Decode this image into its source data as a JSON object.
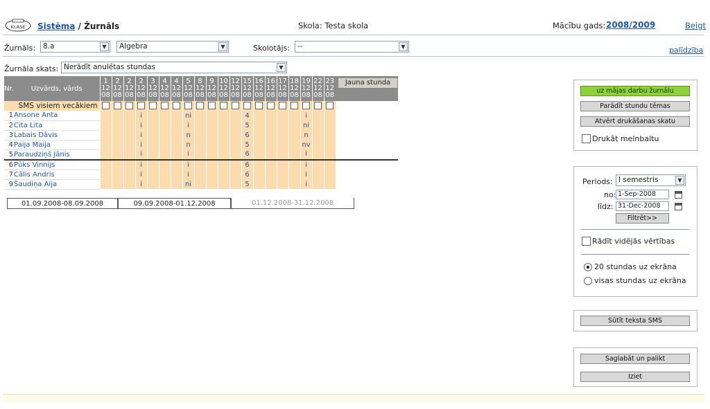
{
  "header": {
    "logo_text": "KLASE",
    "crumb_system": "Sistēma",
    "crumb_sep": " / ",
    "crumb_page": "Žurnāls",
    "school": "Skola: Testa skola",
    "year_label": "Mācību gads:",
    "year_value": "2008/2009",
    "logout": "Beigt"
  },
  "filters": {
    "journal_label": "Žurnāls:",
    "journal_value": "8.a",
    "subject_value": "Algebra",
    "teacher_label": "Skolotājs:",
    "teacher_value": "--",
    "help": "palīdzība",
    "view_label": "Žurnāla skats:",
    "view_value": "Nerādīt anulētas stundas"
  },
  "grid": {
    "col_nr": "Nr.",
    "col_name": "Uzvārds, vārds",
    "new_lesson": "Jauna stunda",
    "lessons": [
      {
        "day": "1",
        "month": "12",
        "year": "08"
      },
      {
        "day": "2",
        "month": "12",
        "year": "08"
      },
      {
        "day": "2",
        "month": "12",
        "year": "08"
      },
      {
        "day": "2",
        "month": "12",
        "year": "08"
      },
      {
        "day": "3",
        "month": "12",
        "year": "08"
      },
      {
        "day": "4",
        "month": "12",
        "year": "08"
      },
      {
        "day": "4",
        "month": "12",
        "year": "08"
      },
      {
        "day": "5",
        "month": "12",
        "year": "08"
      },
      {
        "day": "8",
        "month": "12",
        "year": "08"
      },
      {
        "day": "9",
        "month": "12",
        "year": "08"
      },
      {
        "day": "10",
        "month": "12",
        "year": "08"
      },
      {
        "day": "12",
        "month": "12",
        "year": "08"
      },
      {
        "day": "15",
        "month": "12",
        "year": "08"
      },
      {
        "day": "16",
        "month": "12",
        "year": "08"
      },
      {
        "day": "16",
        "month": "12",
        "year": "08"
      },
      {
        "day": "17",
        "month": "12",
        "year": "08"
      },
      {
        "day": "18",
        "month": "12",
        "year": "08"
      },
      {
        "day": "19",
        "month": "12",
        "year": "08"
      },
      {
        "day": "22",
        "month": "12",
        "year": "08"
      },
      {
        "day": "23",
        "month": "12",
        "year": "08"
      }
    ],
    "sms_label": "SMS visiem vecākiem",
    "students": [
      {
        "nr": "1",
        "name": "Ansone Anta",
        "marks": [
          "",
          "",
          "",
          "i",
          "",
          "",
          "",
          "ni",
          "",
          "",
          "",
          "",
          "4",
          "",
          "",
          "",
          "",
          "i",
          "",
          ""
        ]
      },
      {
        "nr": "2",
        "name": "Cita Lita",
        "marks": [
          "",
          "",
          "",
          "i",
          "",
          "",
          "",
          "i",
          "",
          "",
          "",
          "",
          "5",
          "",
          "",
          "",
          "",
          "ni",
          "",
          ""
        ]
      },
      {
        "nr": "3",
        "name": "Labais Dāvis",
        "marks": [
          "",
          "",
          "",
          "i",
          "",
          "",
          "",
          "n",
          "",
          "",
          "",
          "",
          "6",
          "",
          "",
          "",
          "",
          "n",
          "",
          ""
        ]
      },
      {
        "nr": "4",
        "name": "Paija Maija",
        "marks": [
          "",
          "",
          "",
          "i",
          "",
          "",
          "",
          "n",
          "",
          "",
          "",
          "",
          "5",
          "",
          "",
          "",
          "",
          "nv",
          "",
          ""
        ]
      },
      {
        "nr": "5",
        "name": "Paraudziņš Jānis",
        "marks": [
          "",
          "",
          "",
          "i",
          "",
          "",
          "",
          "i",
          "",
          "",
          "",
          "",
          "6",
          "",
          "",
          "",
          "",
          "i",
          "",
          ""
        ]
      },
      {
        "nr": "6",
        "name": "Pūks Vinnijs",
        "marks": [
          "",
          "",
          "",
          "i",
          "",
          "",
          "",
          "i",
          "",
          "",
          "",
          "",
          "6",
          "",
          "",
          "",
          "",
          "i",
          "",
          ""
        ]
      },
      {
        "nr": "7",
        "name": "Cālis Andris",
        "marks": [
          "",
          "",
          "",
          "i",
          "",
          "",
          "",
          "i",
          "",
          "",
          "",
          "",
          "6",
          "",
          "",
          "",
          "",
          "i",
          "",
          ""
        ]
      },
      {
        "nr": "9",
        "name": "Šaudiņa Aija",
        "marks": [
          "",
          "",
          "",
          "i",
          "",
          "",
          "",
          "ni",
          "",
          "",
          "",
          "",
          "5",
          "",
          "",
          "",
          "",
          "i",
          "",
          ""
        ]
      }
    ]
  },
  "periods": [
    "01.09.2008-08.09.2008",
    "09.09.2008-01.12.2008",
    "01.12.2008-31.12.2008"
  ],
  "panel_actions": {
    "home_journal": "uz mājas darbu žurnālu",
    "show_topics": "Parādīt stundu tēmas",
    "print_view": "Atvērt drukāšanas skatu",
    "print_bw": "Drukāt melnbaltu"
  },
  "panel_period": {
    "period_label": "Periods:",
    "period_value": "I semestris",
    "from_label": "no:",
    "from_value": "1-Sep-2008",
    "to_label": "līdz:",
    "to_value": "31-Dec-2008",
    "filter": "Filtrēt>>",
    "show_avg": "Rādīt vidējās vērtības",
    "opt_20": "20 stundas uz ekrāna",
    "opt_all": "visas stundas uz ekrāna"
  },
  "panel_sms": {
    "send": "Sūtīt teksta SMS"
  },
  "panel_save": {
    "save": "Saglabāt un palikt",
    "exit": "Iziet"
  }
}
